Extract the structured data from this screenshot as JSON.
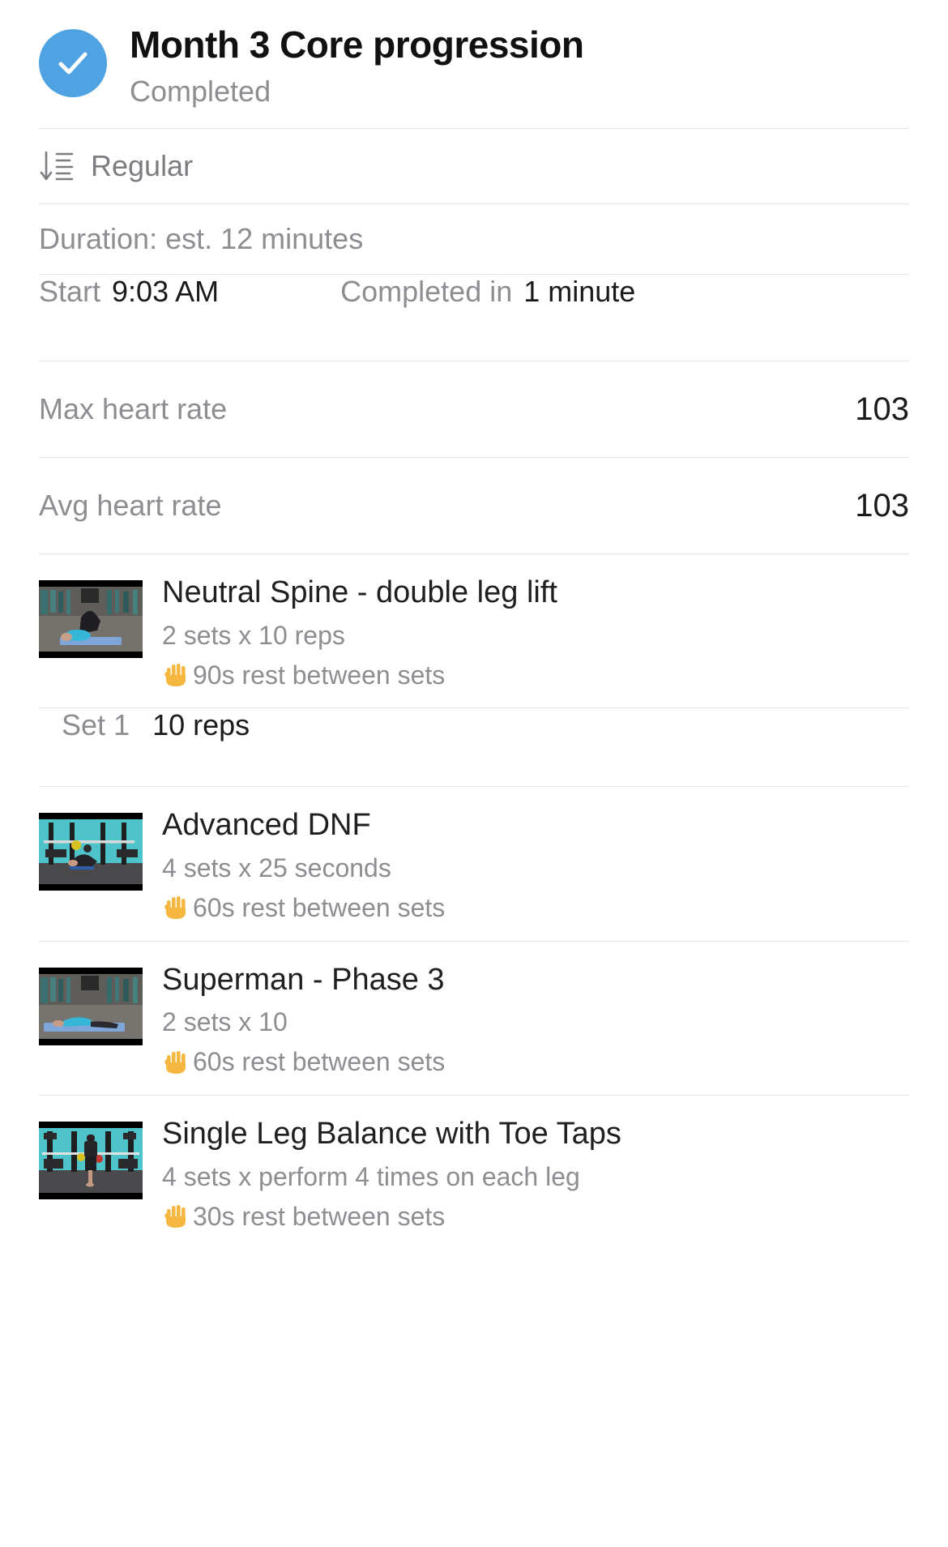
{
  "header": {
    "title": "Month 3 Core progression",
    "status": "Completed",
    "check_icon": "check-circle-icon",
    "accent_color": "#4fa3e3"
  },
  "summary": {
    "type_icon": "sort-descending-icon",
    "type_label": "Regular",
    "duration_label": "Duration: est. 12 minutes",
    "start_key": "Start",
    "start_value": "9:03 AM",
    "completed_key": "Completed in",
    "completed_value": "1 minute",
    "metrics": [
      {
        "label": "Max heart rate",
        "value": "103"
      },
      {
        "label": "Avg heart rate",
        "value": "103"
      }
    ]
  },
  "exercises": [
    {
      "name": "Neutral Spine - double leg lift",
      "scheme": "2 sets x 10 reps",
      "rest": "90s rest between sets",
      "rest_icon": "raised-hand-icon",
      "thumbnail": "gym-floor-blue-mat-leg-lift",
      "sets": [
        {
          "label": "Set 1",
          "value": "10 reps"
        }
      ]
    },
    {
      "name": "Advanced DNF",
      "scheme": "4 sets x 25 seconds",
      "rest": "60s rest between sets",
      "rest_icon": "raised-hand-icon",
      "thumbnail": "teal-wall-squat-rack-floor",
      "sets": []
    },
    {
      "name": "Superman - Phase 3",
      "scheme": "2 sets x 10",
      "rest": "60s rest between sets",
      "rest_icon": "raised-hand-icon",
      "thumbnail": "gym-floor-blue-mat-superman",
      "sets": []
    },
    {
      "name": "Single Leg Balance with Toe Taps",
      "scheme": "4 sets x perform 4 times on each leg",
      "rest": "30s rest between sets",
      "rest_icon": "raised-hand-icon",
      "thumbnail": "teal-wall-standing-balance",
      "sets": []
    }
  ]
}
